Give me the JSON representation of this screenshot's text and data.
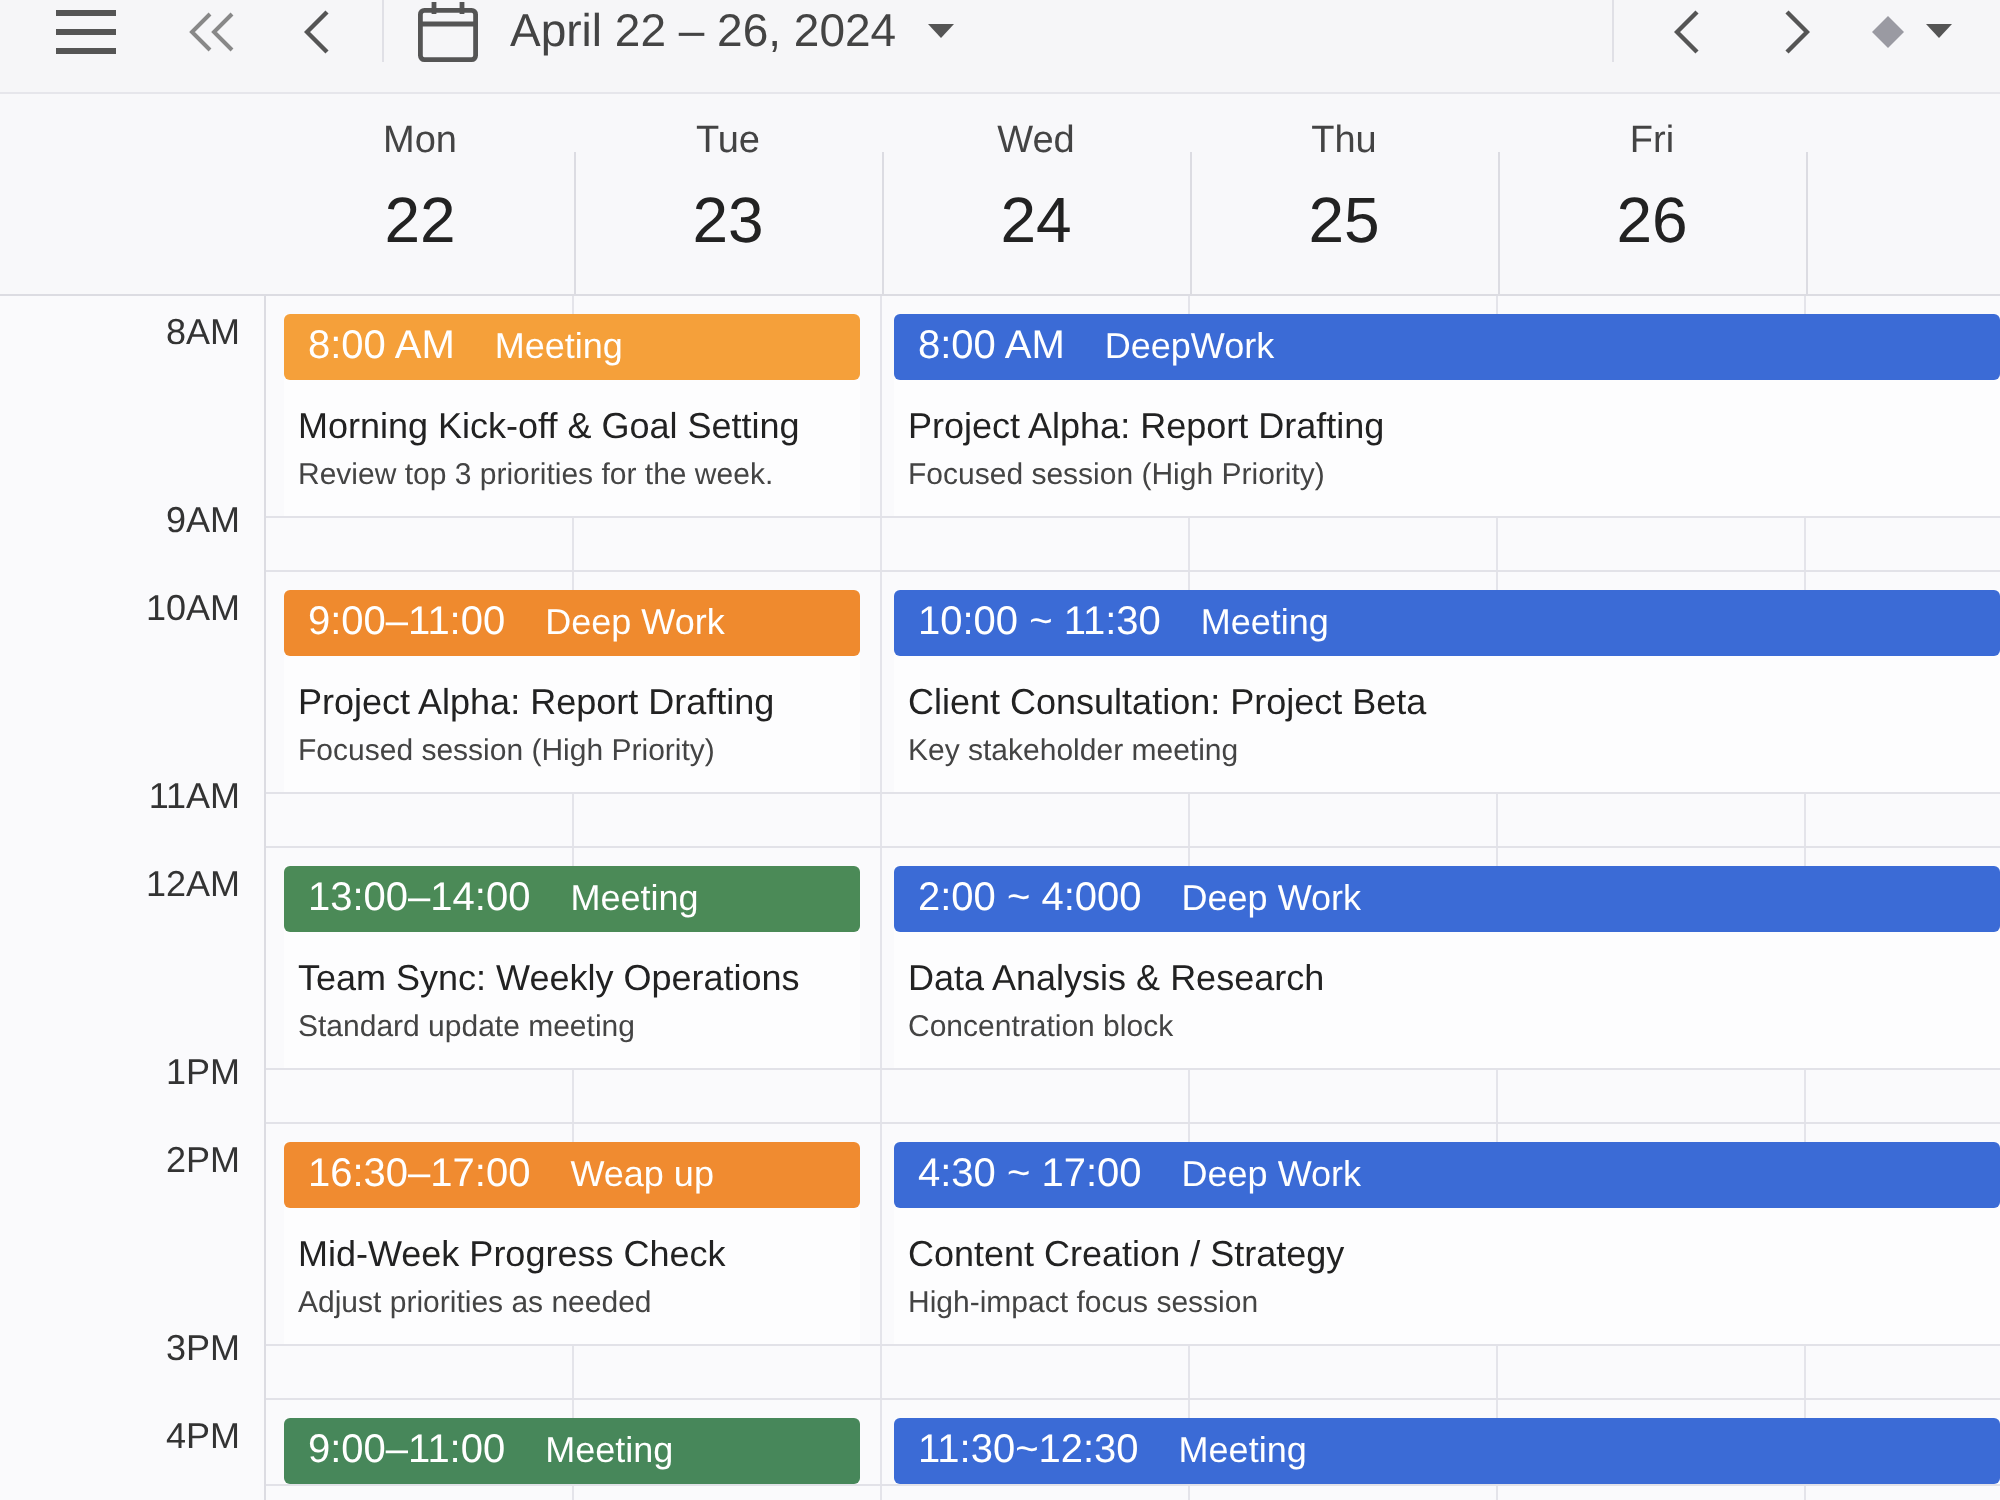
{
  "toolbar": {
    "date_range": "April 22 – 26, 2024"
  },
  "days": [
    {
      "name": "Mon",
      "date": "22"
    },
    {
      "name": "Tue",
      "date": "23"
    },
    {
      "name": "Wed",
      "date": "24"
    },
    {
      "name": "Thu",
      "date": "25"
    },
    {
      "name": "Fri",
      "date": "26"
    }
  ],
  "rows": [
    {
      "times": [
        "8AM",
        "9AM"
      ],
      "events": [
        {
          "time": "8:00 AM",
          "category": "Meeting",
          "color": "#f5a03a",
          "title": "Morning Kick-off & Goal Setting",
          "description": "Review top 3 priorities for the week."
        },
        {
          "time": "8:00 AM",
          "category": "DeepWork",
          "color": "#3b6bd6",
          "title": "Project Alpha: Report Drafting",
          "description": "Focused session (High Priority)"
        }
      ]
    },
    {
      "times": [
        "10AM",
        "11AM"
      ],
      "events": [
        {
          "time": "9:00–11:00",
          "category": "Deep Work",
          "color": "#ef8a2e",
          "title": "Project Alpha: Report Drafting",
          "description": "Focused session (High Priority)"
        },
        {
          "time": "10:00 ~ 11:30",
          "category": "Meeting",
          "color": "#3b6bd6",
          "title": "Client Consultation: Project Beta",
          "description": "Key stakeholder meeting"
        }
      ]
    },
    {
      "times": [
        "12AM",
        "1PM"
      ],
      "events": [
        {
          "time": "13:00–14:00",
          "category": "Meeting",
          "color": "#4b8a57",
          "title": "Team Sync: Weekly Operations",
          "description": "Standard update meeting"
        },
        {
          "time": "2:00 ~ 4:000",
          "category": "Deep Work",
          "color": "#3b6bd6",
          "title": "Data Analysis & Research",
          "description": "Concentration block"
        }
      ]
    },
    {
      "times": [
        "2PM",
        "3PM"
      ],
      "events": [
        {
          "time": "16:30–17:00",
          "category": "Weap up",
          "color": "#f08b30",
          "title": "Mid-Week Progress Check",
          "description": "Adjust priorities as needed"
        },
        {
          "time": "4:30 ~ 17:00",
          "category": "Deep Work",
          "color": "#3b6bd6",
          "title": "Content Creation / Strategy",
          "description": "High-impact focus session"
        }
      ]
    },
    {
      "times": [
        "4PM"
      ],
      "events": [
        {
          "time": "9:00–11:00",
          "category": "Meeting",
          "color": "#47875a"
        },
        {
          "time": "11:30~12:30",
          "category": "Meeting",
          "color": "#3b6bd6"
        }
      ]
    }
  ]
}
